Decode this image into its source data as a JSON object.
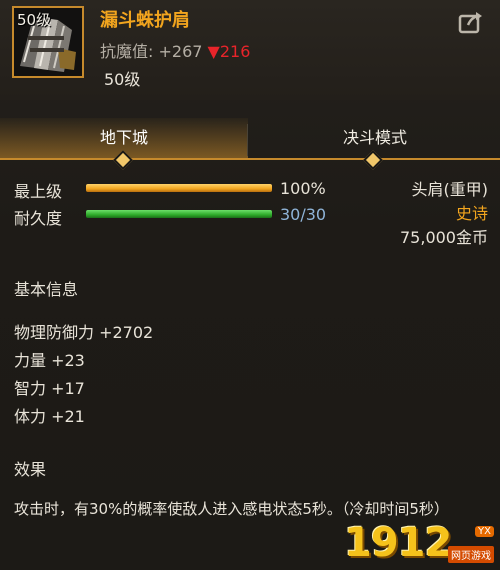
{
  "header": {
    "level_badge": "50级",
    "item_name": "漏斗蛛护肩",
    "stat_label": "抗魔值: +267",
    "stat_down": "▼216",
    "req_level": "50级"
  },
  "tabs": [
    {
      "label": "地下城",
      "active": true
    },
    {
      "label": "决斗模式",
      "active": false
    }
  ],
  "bars": [
    {
      "label": "最上级",
      "value": "100%",
      "fill_percent": 100,
      "color": "#f2a51e"
    },
    {
      "label": "耐久度",
      "value": "30/30",
      "fill_percent": 100,
      "color": "#2eaa2a"
    }
  ],
  "right_info": {
    "slot_type": "头肩(重甲)",
    "rarity": "史诗",
    "price": "75,000金币"
  },
  "basic_info": {
    "title": "基本信息",
    "attributes": [
      "物理防御力 +2702",
      "力量 +23",
      "智力 +17",
      "体力 +21"
    ]
  },
  "effect": {
    "title": "效果",
    "text": "攻击时，有30%的概率使敌人进入感电状态5秒。（冷却时间5秒）"
  },
  "watermark": {
    "digits": "1912",
    "tag": "YX",
    "sub": "网页游戏"
  },
  "colors": {
    "accent": "#c68a2c",
    "item_name": "#f2a51e",
    "rarity": "#f2a51e",
    "down": "#e8242a",
    "value_blue": "#8fb4d8"
  },
  "icons": {
    "share": "share-icon",
    "item": "shoulder-armor-icon"
  }
}
